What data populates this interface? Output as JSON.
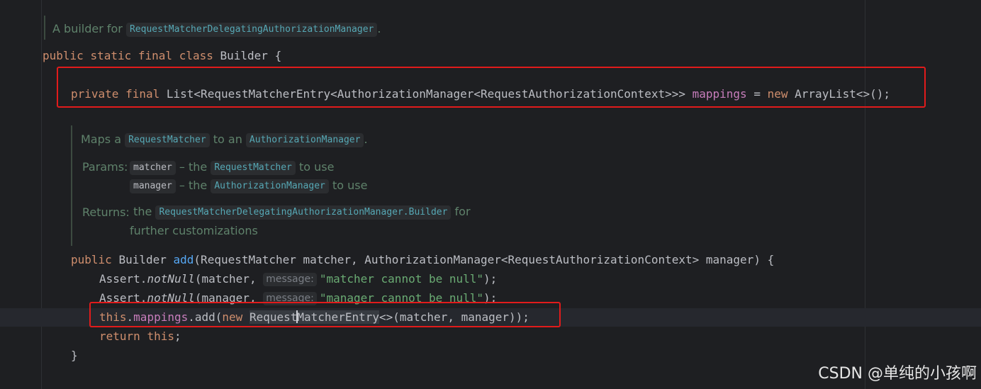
{
  "doc_class": {
    "prefix": "A builder for ",
    "ref": "RequestMatcherDelegatingAuthorizationManager",
    "suffix": "."
  },
  "code_class_decl": {
    "kw1": "public",
    "kw2": "static",
    "kw3": "final",
    "kw4": "class",
    "name": "Builder",
    "brace": "{"
  },
  "code_field": {
    "kw1": "private",
    "kw2": "final",
    "type": "List<RequestMatcherEntry<AuthorizationManager<RequestAuthorizationContext>>>",
    "name": "mappings",
    "eq": "=",
    "kw3": "new",
    "init": "ArrayList<>();"
  },
  "doc_method": {
    "line1_a": "Maps a ",
    "line1_ref1": "RequestMatcher",
    "line1_b": " to an ",
    "line1_ref2": "AuthorizationManager",
    "line1_c": ".",
    "params_label": "Params:",
    "param1_name": "matcher",
    "param1_a": " – the ",
    "param1_ref": "RequestMatcher",
    "param1_b": " to use",
    "param2_name": "manager",
    "param2_a": " – the ",
    "param2_ref": "AuthorizationManager",
    "param2_b": " to use",
    "returns_label": "Returns:",
    "returns_a": " the ",
    "returns_ref": "RequestMatcherDelegatingAuthorizationManager.Builder",
    "returns_b": " for",
    "returns_line2": "further customizations"
  },
  "code_method_sig": {
    "kw1": "public",
    "ret": "Builder",
    "name": "add",
    "params": "(RequestMatcher matcher, AuthorizationManager<RequestAuthorizationContext> manager) {"
  },
  "code_assert1": {
    "cls": "Assert.",
    "m": "notNull",
    "open": "(matcher, ",
    "hint": "message:",
    "str": "\"matcher cannot be null\"",
    "close": ");"
  },
  "code_assert2": {
    "cls": "Assert.",
    "m": "notNull",
    "open": "(manager, ",
    "hint": "message:",
    "str": "\"manager cannot be null\"",
    "close": ");"
  },
  "code_add": {
    "kw_this": "this",
    "dot": ".",
    "field": "mappings",
    "call": ".add(",
    "kw_new": "new",
    "cls_a": "Request",
    "cls_b": "MatcherEntry",
    "rest": "<>(matcher, manager));"
  },
  "code_return": {
    "kw_return": "return",
    "kw_this": "this",
    "semi": ";"
  },
  "code_close_brace": "}",
  "watermark": "CSDN @单纯的小孩啊",
  "colors": {
    "background": "#1e1f22",
    "keyword": "#cf8e6d",
    "field": "#c77dbb",
    "method": "#56a8f5",
    "string": "#6aab73",
    "doc_text": "#5f826b",
    "highlight_box": "#e11b1b"
  }
}
